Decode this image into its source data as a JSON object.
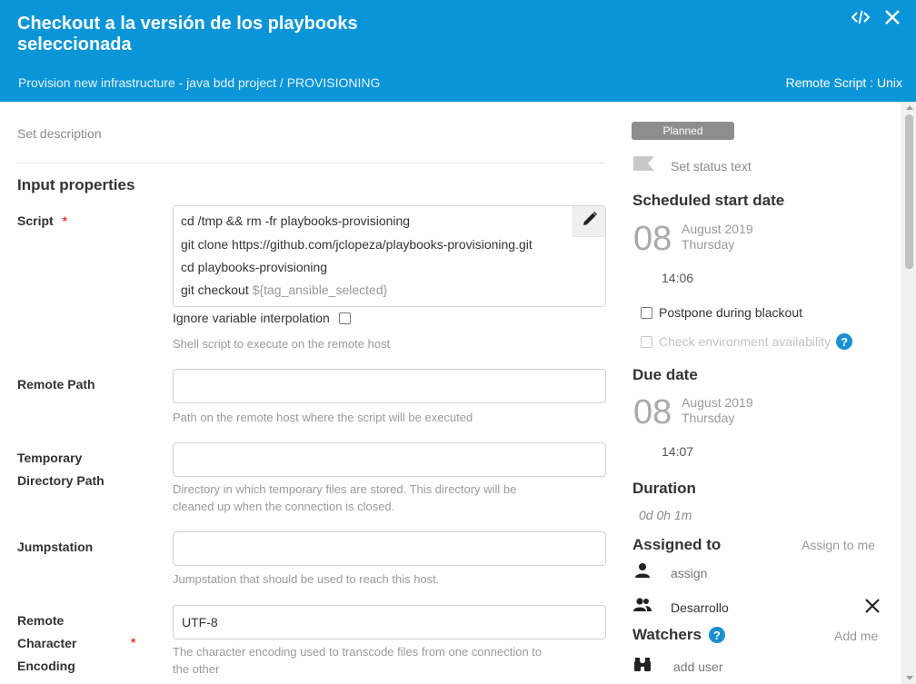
{
  "header": {
    "title": "Checkout a la versión de los playbooks seleccionada",
    "breadcrumb": "Provision new infrastructure - java bdd project / PROVISIONING",
    "task_type": "Remote Script : Unix",
    "icons": [
      "code-icon",
      "close-icon"
    ]
  },
  "main": {
    "description_placeholder": "Set description",
    "section_title": "Input properties",
    "script": {
      "label": "Script",
      "required_mark": "*",
      "lines": [
        "cd /tmp && rm -fr playbooks-provisioning",
        "git clone https://github.com/jclopeza/playbooks-provisioning.git",
        "cd playbooks-provisioning",
        "git checkout "
      ],
      "variable": "${tag_ansible_selected}",
      "ignore_interpolation_label": "Ignore variable interpolation",
      "help": "Shell script to execute on the remote host"
    },
    "remote_path": {
      "label": "Remote Path",
      "value": "",
      "help": "Path on the remote host where the script will be executed"
    },
    "temp_dir": {
      "label_line1": "Temporary",
      "label_line2": "Directory Path",
      "value": "",
      "help_line1": "Directory in which temporary files are stored. This directory will be",
      "help_line2": "cleaned up when the connection is closed."
    },
    "jumpstation": {
      "label": "Jumpstation",
      "value": "",
      "help": "Jumpstation that should be used to reach this host."
    },
    "encoding": {
      "label_line1": "Remote",
      "label_line2": "Character",
      "label_line3": "Encoding",
      "required_mark": "*",
      "value": "UTF-8",
      "help_line1": "The character encoding used to transcode files from one connection to",
      "help_line2": "the other"
    }
  },
  "side": {
    "status_badge": "Planned",
    "status_text_placeholder": "Set status text",
    "scheduled": {
      "title": "Scheduled start date",
      "day": "08",
      "month_year": "August 2019",
      "weekday": "Thursday",
      "time": "14:06"
    },
    "postpone_label": "Postpone during blackout",
    "check_env_label": "Check environment availability",
    "due": {
      "title": "Due date",
      "day": "08",
      "month_year": "August 2019",
      "weekday": "Thursday",
      "time": "14:07"
    },
    "duration": {
      "title": "Duration",
      "value": "0d 0h 1m"
    },
    "assigned": {
      "title": "Assigned to",
      "assign_to_me": "Assign to me",
      "assign_placeholder": "assign",
      "team": "Desarrollo"
    },
    "watchers": {
      "title": "Watchers",
      "add_me": "Add me",
      "add_user_placeholder": "add user"
    }
  },
  "colors": {
    "header_bg": "#0a95d8",
    "badge_bg": "#8d8d8d",
    "required": "#d9412c",
    "help_icon": "#1a8fd1"
  }
}
